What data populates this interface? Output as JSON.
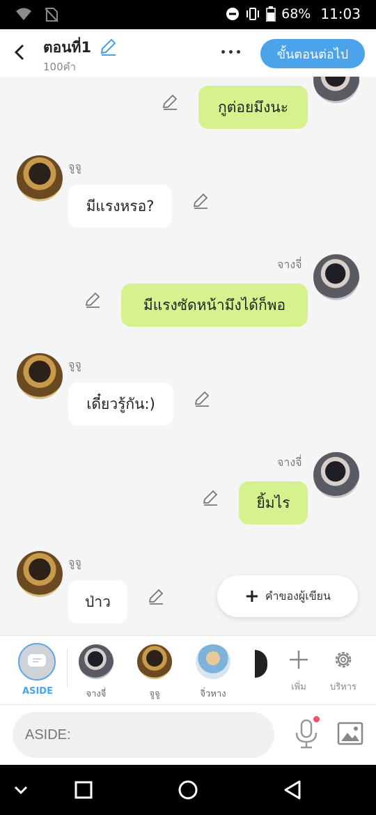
{
  "status_bar": {
    "battery": "68%",
    "time": "11:03"
  },
  "header": {
    "title": "ตอนที่1",
    "word_count": "100คำ",
    "next_button": "ขั้นตอนต่อไป"
  },
  "messages": [
    {
      "side": "me",
      "speaker": "",
      "text": "กูต่อยมึงนะ"
    },
    {
      "side": "them",
      "speaker": "จูจู",
      "text": "มีแรงหรอ?"
    },
    {
      "side": "me",
      "speaker": "จางจี่",
      "text": "มีแรงซัดหน้ามึงได้ก็พอ"
    },
    {
      "side": "them",
      "speaker": "จูจู",
      "text": "เดี๋ยวรู้กัน:)"
    },
    {
      "side": "me",
      "speaker": "จางจี่",
      "text": "ยิ้มไร"
    },
    {
      "side": "them",
      "speaker": "จูจู",
      "text": "ป่าว"
    }
  ],
  "fab": {
    "label": "คำของผู้เขียน"
  },
  "characters": {
    "aside_label": "ASIDE",
    "list": [
      {
        "name": "จางจี่"
      },
      {
        "name": "จูจู"
      },
      {
        "name": "จิ่วหาง"
      }
    ],
    "add_label": "เพิ่ม",
    "manage_label": "บริหาร"
  },
  "input": {
    "placeholder": "ASIDE:"
  },
  "colors": {
    "accent": "#4ba3ec",
    "my_bubble": "#d6f28f",
    "their_bubble": "#ffffff"
  }
}
